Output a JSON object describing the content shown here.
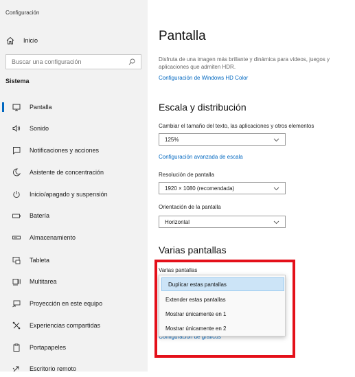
{
  "sidebar": {
    "app_title": "Configuración",
    "home_label": "Inicio",
    "search_placeholder": "Buscar una configuración",
    "section_title": "Sistema",
    "items": [
      {
        "label": "Pantalla",
        "icon": "monitor-icon",
        "active": true
      },
      {
        "label": "Sonido",
        "icon": "speaker-icon"
      },
      {
        "label": "Notificaciones y acciones",
        "icon": "notification-icon"
      },
      {
        "label": "Asistente de concentración",
        "icon": "moon-icon"
      },
      {
        "label": "Inicio/apagado y suspensión",
        "icon": "power-icon"
      },
      {
        "label": "Batería",
        "icon": "battery-icon"
      },
      {
        "label": "Almacenamiento",
        "icon": "storage-icon"
      },
      {
        "label": "Tableta",
        "icon": "tablet-icon"
      },
      {
        "label": "Multitarea",
        "icon": "multitask-icon"
      },
      {
        "label": "Proyección en este equipo",
        "icon": "projection-icon"
      },
      {
        "label": "Experiencias compartidas",
        "icon": "shared-icon"
      },
      {
        "label": "Portapapeles",
        "icon": "clipboard-icon"
      },
      {
        "label": "Escritorio remoto",
        "icon": "remote-desktop-icon"
      }
    ]
  },
  "main": {
    "title": "Pantalla",
    "hdr_description": "Disfruta de una imagen más brillante y dinámica para vídeos, juegos y aplicaciones que admiten HDR.",
    "hdr_link": "Configuración de Windows HD Color",
    "scale_heading": "Escala y distribución",
    "scale_label": "Cambiar el tamaño del texto, las aplicaciones y otros elementos",
    "scale_value": "125%",
    "scale_advanced_link": "Configuración avanzada de escala",
    "resolution_label": "Resolución de pantalla",
    "resolution_value": "1920 × 1080 (recomendada)",
    "orientation_label": "Orientación de la pantalla",
    "orientation_value": "Horizontal",
    "multi_heading": "Varias pantallas",
    "multi_label": "Varias pantallas",
    "multi_options": [
      "Duplicar estas pantallas",
      "Extender estas pantallas",
      "Mostrar únicamente en 1",
      "Mostrar únicamente en 2"
    ],
    "multi_selected_index": 0,
    "graphics_link": "Configuración de gráficos"
  },
  "colors": {
    "accent": "#0067c0",
    "highlight_border": "#e4101a"
  }
}
